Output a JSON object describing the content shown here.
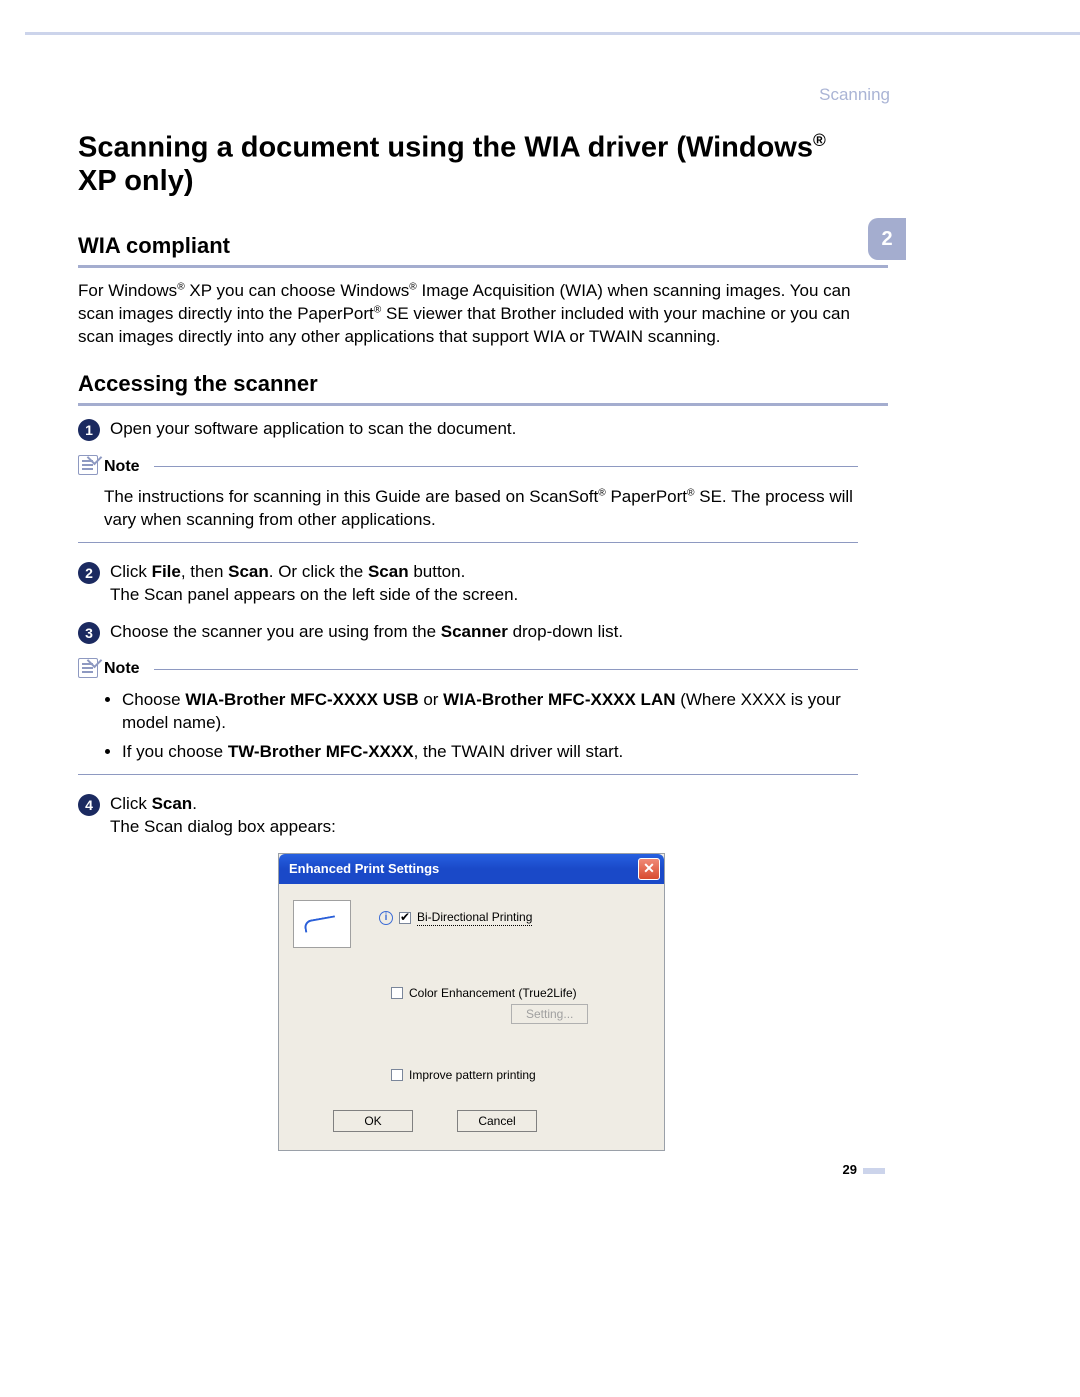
{
  "header": {
    "section": "Scanning"
  },
  "tab": {
    "number": "2"
  },
  "title": {
    "line1_pre": "Scanning a document using the WIA driver (Windows",
    "line1_sup": "®",
    "line1_post": " XP only)"
  },
  "sec1": {
    "heading": "WIA compliant",
    "p1_a": "For Windows",
    "p1_sup1": "®",
    "p1_b": " XP you can choose Windows",
    "p1_sup2": "®",
    "p1_c": " Image Acquisition (WIA) when scanning images. You can scan images directly into the PaperPort",
    "p1_sup3": "®",
    "p1_d": " SE viewer that Brother included with your machine or you can scan images directly into any other applications that support WIA or TWAIN scanning."
  },
  "sec2": {
    "heading": "Accessing the scanner",
    "step1": {
      "num": "1",
      "text": "Open your software application to scan the document."
    },
    "note1": {
      "label": "Note",
      "body_a": "The instructions for scanning in this Guide are based on ScanSoft",
      "body_sup1": "®",
      "body_b": " PaperPort",
      "body_sup2": "®",
      "body_c": " SE. The process will vary when scanning from other applications."
    },
    "step2": {
      "num": "2",
      "t1": "Click ",
      "b1": "File",
      "t2": ", then ",
      "b2": "Scan",
      "t3": ". Or click the ",
      "b3": "Scan",
      "t4": " button.",
      "line2": "The Scan panel appears on the left side of the screen."
    },
    "step3": {
      "num": "3",
      "t1": "Choose the scanner you are using from the ",
      "b1": "Scanner",
      "t2": " drop-down list."
    },
    "note2": {
      "label": "Note",
      "li1_a": "Choose ",
      "li1_b1": "WIA-Brother MFC-XXXX USB",
      "li1_b": " or ",
      "li1_b2": "WIA-Brother MFC-XXXX LAN",
      "li1_c": " (Where XXXX is your model name).",
      "li2_a": "If you choose ",
      "li2_b1": "TW-Brother MFC-XXXX",
      "li2_b": ", the TWAIN driver will start."
    },
    "step4": {
      "num": "4",
      "t1": "Click ",
      "b1": "Scan",
      "t2": ".",
      "line2": "The Scan dialog box appears:"
    }
  },
  "dialog": {
    "title": "Enhanced Print Settings",
    "close": "✕",
    "info": "i",
    "opt1_checked": true,
    "opt1_label": "Bi-Directional Printing",
    "opt2_checked": false,
    "opt2_label": "Color Enhancement (True2Life)",
    "setting_btn": "Setting...",
    "opt3_checked": false,
    "opt3_label": "Improve pattern printing",
    "ok": "OK",
    "cancel": "Cancel"
  },
  "footer": {
    "page": "29"
  }
}
